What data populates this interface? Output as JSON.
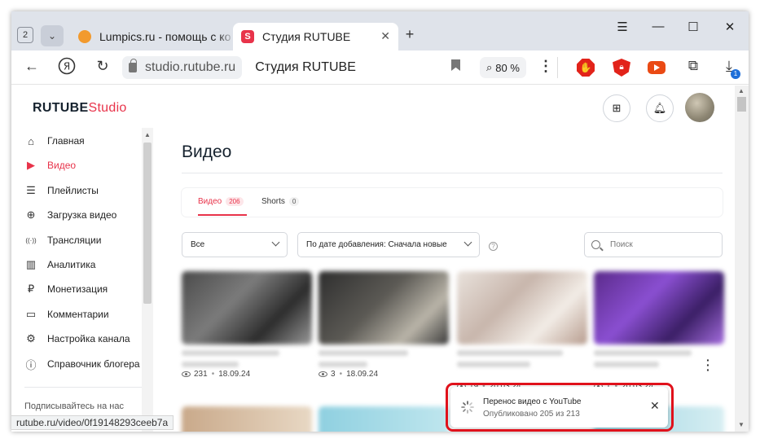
{
  "browser": {
    "tab_count": "2",
    "tabs": [
      {
        "title": "Lumpics.ru - помощь с ко",
        "active": false
      },
      {
        "title": "Студия RUTUBE",
        "active": true
      }
    ],
    "url_domain": "studio.rutube.ru",
    "page_title": "Студия RUTUBE",
    "zoom": "80 %",
    "downloads_badge": "1",
    "status_url": "rutube.ru/video/0f19148293ceeb7a"
  },
  "header": {
    "logo_main": "RUTUBE",
    "logo_suffix": "Studio"
  },
  "sidebar": {
    "items": [
      {
        "label": "Главная",
        "icon": "home-icon",
        "glyph": "⌂"
      },
      {
        "label": "Видео",
        "icon": "video-icon",
        "glyph": "▶"
      },
      {
        "label": "Плейлисты",
        "icon": "playlist-icon",
        "glyph": "☰"
      },
      {
        "label": "Загрузка видео",
        "icon": "upload-icon",
        "glyph": "⊕"
      },
      {
        "label": "Трансляции",
        "icon": "broadcast-icon",
        "glyph": "((·))"
      },
      {
        "label": "Аналитика",
        "icon": "analytics-icon",
        "glyph": "▥"
      },
      {
        "label": "Монетизация",
        "icon": "ruble-icon",
        "glyph": "₽"
      },
      {
        "label": "Комментарии",
        "icon": "comment-icon",
        "glyph": "▭"
      },
      {
        "label": "Настройка канала",
        "icon": "settings-icon",
        "glyph": "⚙"
      },
      {
        "label": "Справочник блогера",
        "icon": "help-book-icon",
        "glyph": "ⓘ"
      }
    ],
    "subscribe_text": "Подписывайтесь на нас"
  },
  "main": {
    "title": "Видео",
    "tabs": [
      {
        "label": "Видео",
        "count": "206"
      },
      {
        "label": "Shorts",
        "count": "0"
      }
    ],
    "filter_all": "Все",
    "sort": "По дате добавления: Сначала новые",
    "search_placeholder": "Поиск",
    "videos": [
      {
        "views": "231",
        "date": "18.09.24"
      },
      {
        "views": "3",
        "date": "18.09.24"
      },
      {
        "views": "19",
        "date": "20.03.24"
      },
      {
        "views": "1",
        "date": "20.03.24"
      }
    ]
  },
  "toast": {
    "title": "Перенос видео с YouTube",
    "progress_text": "Опубликовано 205 из 213"
  },
  "colors": {
    "accent": "#e8334a",
    "highlight": "#e0111b"
  }
}
